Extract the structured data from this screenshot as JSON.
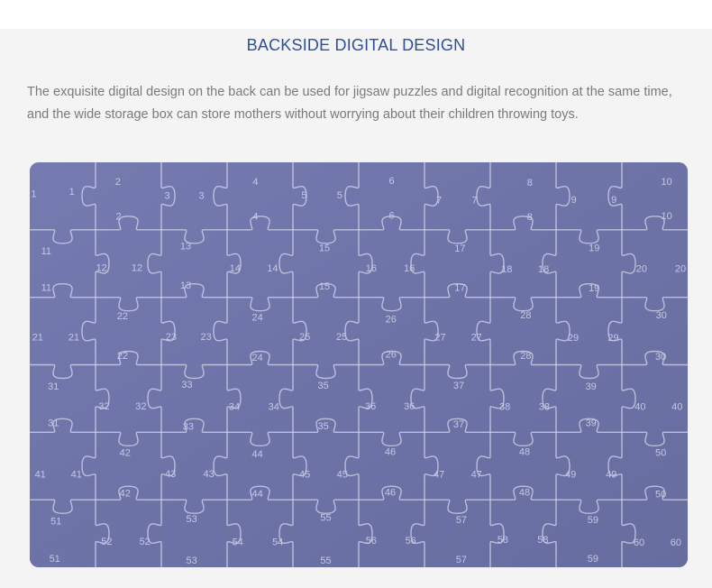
{
  "section": {
    "title": "BACKSIDE DIGITAL DESIGN",
    "description": "The exquisite digital design on the back can be used for jigsaw puzzles and digital recognition at the same time, and the wide storage box can store mothers without worrying about their children throwing toys."
  },
  "photo": {
    "description": "Back side of a blue-purple jigsaw puzzle showing printed piece numbers",
    "numbers": [
      {
        "n": "1",
        "p": [
          [
            0.006,
            0.077
          ],
          [
            0.064,
            0.071
          ]
        ]
      },
      {
        "n": "2",
        "p": [
          [
            0.134,
            0.047
          ],
          [
            0.135,
            0.133
          ]
        ]
      },
      {
        "n": "3",
        "p": [
          [
            0.209,
            0.081
          ],
          [
            0.261,
            0.081
          ]
        ]
      },
      {
        "n": "4",
        "p": [
          [
            0.343,
            0.047
          ],
          [
            0.343,
            0.133
          ]
        ]
      },
      {
        "n": "5",
        "p": [
          [
            0.417,
            0.08
          ],
          [
            0.471,
            0.08
          ]
        ]
      },
      {
        "n": "6",
        "p": [
          [
            0.55,
            0.044
          ],
          [
            0.55,
            0.13
          ]
        ]
      },
      {
        "n": "7",
        "p": [
          [
            0.622,
            0.092
          ],
          [
            0.676,
            0.092
          ]
        ]
      },
      {
        "n": "8",
        "p": [
          [
            0.76,
            0.049
          ],
          [
            0.76,
            0.134
          ]
        ]
      },
      {
        "n": "9",
        "p": [
          [
            0.827,
            0.091
          ],
          [
            0.888,
            0.091
          ]
        ]
      },
      {
        "n": "10",
        "p": [
          [
            0.968,
            0.047
          ],
          [
            0.968,
            0.131
          ]
        ]
      },
      {
        "n": "11",
        "p": [
          [
            0.025,
            0.218
          ],
          [
            0.025,
            0.309
          ]
        ]
      },
      {
        "n": "12",
        "p": [
          [
            0.109,
            0.259
          ],
          [
            0.163,
            0.259
          ]
        ]
      },
      {
        "n": "13",
        "p": [
          [
            0.237,
            0.206
          ],
          [
            0.237,
            0.303
          ]
        ]
      },
      {
        "n": "14",
        "p": [
          [
            0.312,
            0.261
          ],
          [
            0.369,
            0.261
          ]
        ]
      },
      {
        "n": "15",
        "p": [
          [
            0.448,
            0.21
          ],
          [
            0.448,
            0.305
          ]
        ]
      },
      {
        "n": "16",
        "p": [
          [
            0.519,
            0.261
          ],
          [
            0.577,
            0.261
          ]
        ]
      },
      {
        "n": "17",
        "p": [
          [
            0.654,
            0.212
          ],
          [
            0.654,
            0.308
          ]
        ]
      },
      {
        "n": "18",
        "p": [
          [
            0.725,
            0.263
          ],
          [
            0.781,
            0.263
          ]
        ]
      },
      {
        "n": "19",
        "p": [
          [
            0.858,
            0.21
          ],
          [
            0.858,
            0.31
          ]
        ]
      },
      {
        "n": "20",
        "p": [
          [
            0.93,
            0.262
          ],
          [
            0.989,
            0.262
          ]
        ]
      },
      {
        "n": "21",
        "p": [
          [
            0.012,
            0.431
          ],
          [
            0.067,
            0.431
          ]
        ]
      },
      {
        "n": "22",
        "p": [
          [
            0.141,
            0.379
          ],
          [
            0.141,
            0.477
          ]
        ]
      },
      {
        "n": "23",
        "p": [
          [
            0.215,
            0.43
          ],
          [
            0.268,
            0.43
          ]
        ]
      },
      {
        "n": "24",
        "p": [
          [
            0.346,
            0.382
          ],
          [
            0.346,
            0.481
          ]
        ]
      },
      {
        "n": "25",
        "p": [
          [
            0.418,
            0.43
          ],
          [
            0.474,
            0.43
          ]
        ]
      },
      {
        "n": "26",
        "p": [
          [
            0.549,
            0.386
          ],
          [
            0.549,
            0.473
          ]
        ]
      },
      {
        "n": "27",
        "p": [
          [
            0.624,
            0.431
          ],
          [
            0.679,
            0.431
          ]
        ]
      },
      {
        "n": "28",
        "p": [
          [
            0.754,
            0.376
          ],
          [
            0.754,
            0.477
          ]
        ]
      },
      {
        "n": "29",
        "p": [
          [
            0.826,
            0.432
          ],
          [
            0.887,
            0.432
          ]
        ]
      },
      {
        "n": "30",
        "p": [
          [
            0.96,
            0.376
          ],
          [
            0.959,
            0.479
          ]
        ]
      },
      {
        "n": "31",
        "p": [
          [
            0.036,
            0.552
          ],
          [
            0.036,
            0.643
          ]
        ]
      },
      {
        "n": "32",
        "p": [
          [
            0.113,
            0.601
          ],
          [
            0.169,
            0.601
          ]
        ]
      },
      {
        "n": "33",
        "p": [
          [
            0.239,
            0.548
          ],
          [
            0.241,
            0.652
          ]
        ]
      },
      {
        "n": "34",
        "p": [
          [
            0.311,
            0.603
          ],
          [
            0.371,
            0.603
          ]
        ]
      },
      {
        "n": "35",
        "p": [
          [
            0.446,
            0.55
          ],
          [
            0.446,
            0.65
          ]
        ]
      },
      {
        "n": "36",
        "p": [
          [
            0.518,
            0.601
          ],
          [
            0.577,
            0.601
          ]
        ]
      },
      {
        "n": "37",
        "p": [
          [
            0.652,
            0.55
          ],
          [
            0.652,
            0.646
          ]
        ]
      },
      {
        "n": "38",
        "p": [
          [
            0.722,
            0.603
          ],
          [
            0.782,
            0.603
          ]
        ]
      },
      {
        "n": "39",
        "p": [
          [
            0.853,
            0.552
          ],
          [
            0.853,
            0.643
          ]
        ]
      },
      {
        "n": "40",
        "p": [
          [
            0.928,
            0.603
          ],
          [
            0.984,
            0.603
          ]
        ]
      },
      {
        "n": "41",
        "p": [
          [
            0.016,
            0.77
          ],
          [
            0.071,
            0.77
          ]
        ]
      },
      {
        "n": "42",
        "p": [
          [
            0.145,
            0.716
          ],
          [
            0.145,
            0.816
          ]
        ]
      },
      {
        "n": "43",
        "p": [
          [
            0.214,
            0.768
          ],
          [
            0.272,
            0.768
          ]
        ]
      },
      {
        "n": "44",
        "p": [
          [
            0.346,
            0.719
          ],
          [
            0.346,
            0.817
          ]
        ]
      },
      {
        "n": "45",
        "p": [
          [
            0.418,
            0.77
          ],
          [
            0.475,
            0.77
          ]
        ]
      },
      {
        "n": "46",
        "p": [
          [
            0.548,
            0.714
          ],
          [
            0.548,
            0.814
          ]
        ]
      },
      {
        "n": "47",
        "p": [
          [
            0.622,
            0.77
          ],
          [
            0.679,
            0.77
          ]
        ]
      },
      {
        "n": "48",
        "p": [
          [
            0.752,
            0.714
          ],
          [
            0.752,
            0.814
          ]
        ]
      },
      {
        "n": "49",
        "p": [
          [
            0.822,
            0.77
          ],
          [
            0.884,
            0.77
          ]
        ]
      },
      {
        "n": "50",
        "p": [
          [
            0.959,
            0.716
          ],
          [
            0.959,
            0.819
          ]
        ]
      },
      {
        "n": "51",
        "p": [
          [
            0.04,
            0.885
          ],
          [
            0.038,
            0.978
          ]
        ]
      },
      {
        "n": "52",
        "p": [
          [
            0.117,
            0.935
          ],
          [
            0.175,
            0.935
          ]
        ]
      },
      {
        "n": "53",
        "p": [
          [
            0.246,
            0.88
          ],
          [
            0.246,
            0.982
          ]
        ]
      },
      {
        "n": "54",
        "p": [
          [
            0.316,
            0.936
          ],
          [
            0.377,
            0.936
          ]
        ]
      },
      {
        "n": "55",
        "p": [
          [
            0.45,
            0.876
          ],
          [
            0.45,
            0.982
          ]
        ]
      },
      {
        "n": "56",
        "p": [
          [
            0.519,
            0.933
          ],
          [
            0.579,
            0.933
          ]
        ]
      },
      {
        "n": "57",
        "p": [
          [
            0.656,
            0.882
          ],
          [
            0.656,
            0.98
          ]
        ]
      },
      {
        "n": "58",
        "p": [
          [
            0.719,
            0.931
          ],
          [
            0.78,
            0.931
          ]
        ]
      },
      {
        "n": "59",
        "p": [
          [
            0.856,
            0.882
          ],
          [
            0.856,
            0.978
          ]
        ]
      },
      {
        "n": "60",
        "p": [
          [
            0.926,
            0.938
          ],
          [
            0.982,
            0.938
          ]
        ]
      }
    ]
  },
  "colors": {
    "title": "#2f4f9a",
    "text": "#7a7a7a",
    "puzzle": "#6e74a8",
    "number": "#c4c8e6"
  }
}
